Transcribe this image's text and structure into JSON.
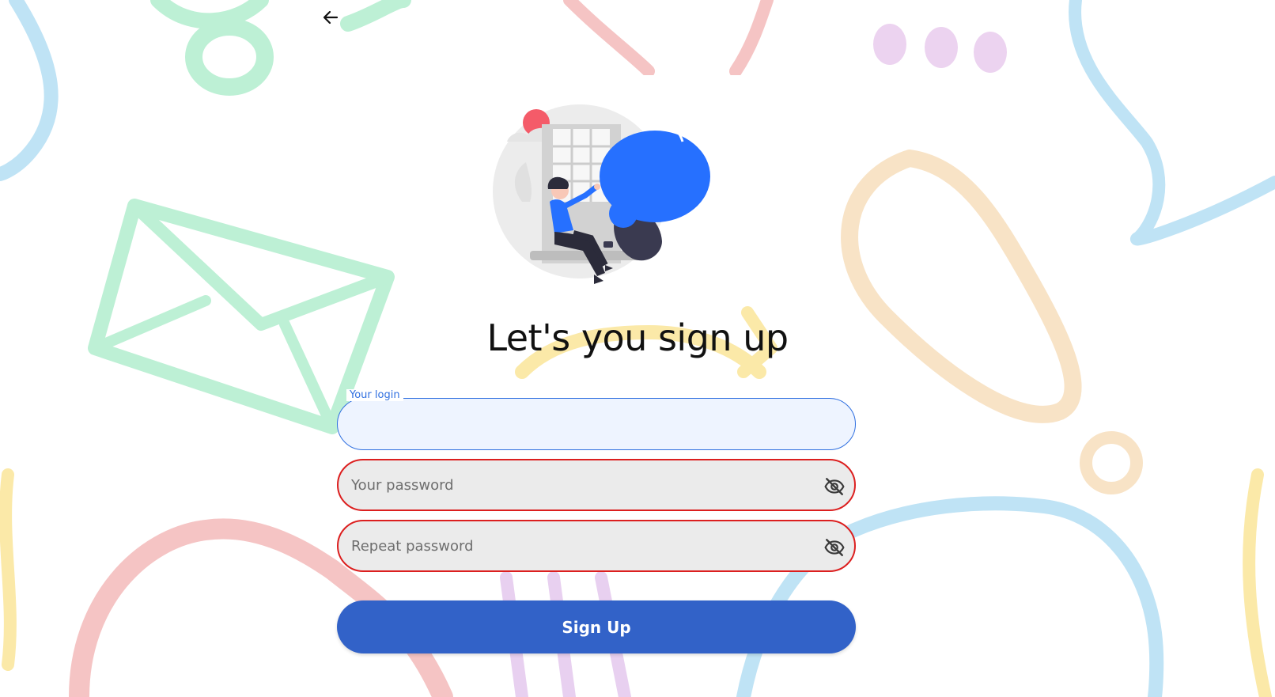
{
  "header": {
    "back_icon": "arrow-left-icon"
  },
  "page": {
    "title": "Let's you sign up"
  },
  "form": {
    "login": {
      "label": "Your login",
      "value": "",
      "placeholder": ""
    },
    "password": {
      "placeholder": "Your password",
      "value": "",
      "toggle_icon": "eye-off-icon"
    },
    "repeat_password": {
      "placeholder": "Repeat password",
      "value": "",
      "toggle_icon": "eye-off-icon"
    },
    "submit_label": "Sign Up"
  },
  "colors": {
    "primary": "#3262c8",
    "focus": "#2f6fe0",
    "error": "#dc1f1f",
    "field_bg": "#ebebeb"
  }
}
